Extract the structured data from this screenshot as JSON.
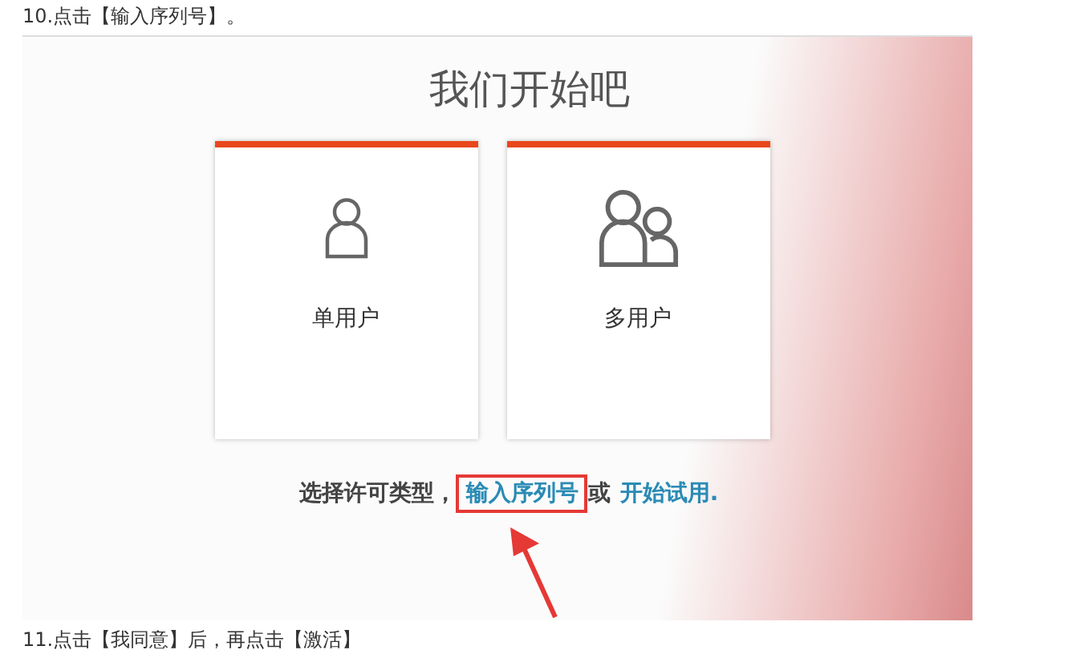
{
  "steps": [
    {
      "text": "10.点击【输入序列号】。"
    },
    {
      "text": "11.点击【我同意】后，再点击【激活】"
    }
  ],
  "screenshot": {
    "title": "我们开始吧",
    "cards": [
      {
        "label": "单用户",
        "kind": "single"
      },
      {
        "label": "多用户",
        "kind": "multi"
      }
    ],
    "prompt": "选择许可类型，",
    "links": [
      {
        "text": "输入序列号",
        "highlighted": true
      },
      {
        "text": "开始试用.",
        "highlighted": false
      }
    ],
    "separator": "或"
  }
}
